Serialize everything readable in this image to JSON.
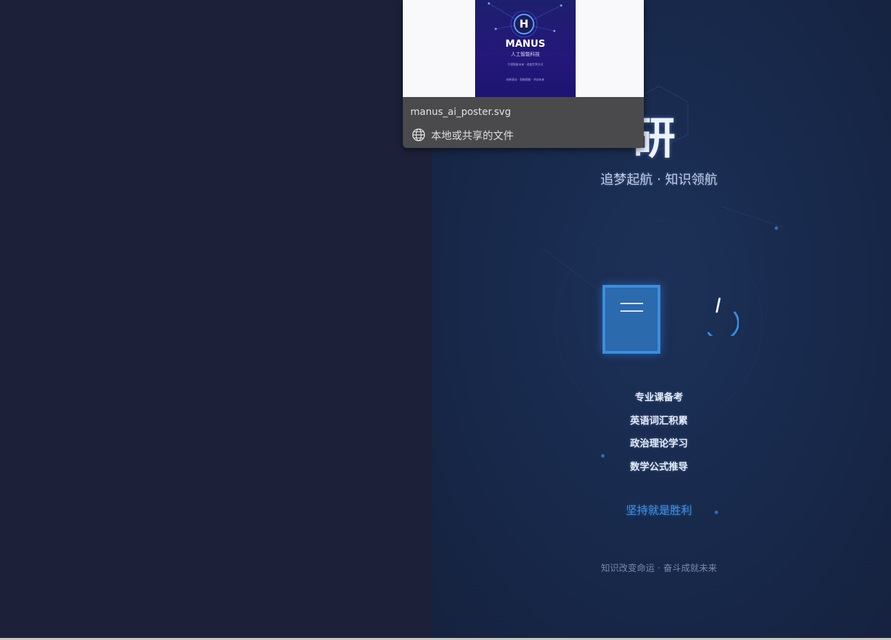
{
  "poster": {
    "title_visible_glyph": "研",
    "subtitle": "追梦起航 · 知识领航",
    "features": [
      "专业课备考",
      "英语词汇积累",
      "政治理论学习",
      "数学公式推导"
    ],
    "motto": "坚持就是胜利",
    "footer": "知识改变命运 · 奋斗成就未来"
  },
  "file_popup": {
    "file_name": "manus_ai_poster.svg",
    "location": "本地或共享的文件",
    "thumbnail": {
      "badge_letter": "H",
      "title": "MANUS",
      "subtitle": "人工智能科技",
      "tagline": "引领智能未来 · 改变世界方式",
      "bottom_line": "创新驱动 · 智能赋能 · 共创未来"
    }
  },
  "colors": {
    "left_pane": "#1d2039",
    "poster_bg": "#182a4d",
    "accent_blue": "#3e8fe0",
    "popup_info_bg": "#4a4a4d"
  },
  "icons": {
    "globe": "globe-icon",
    "book": "book-icon",
    "spinner": "loading-spinner-icon"
  }
}
